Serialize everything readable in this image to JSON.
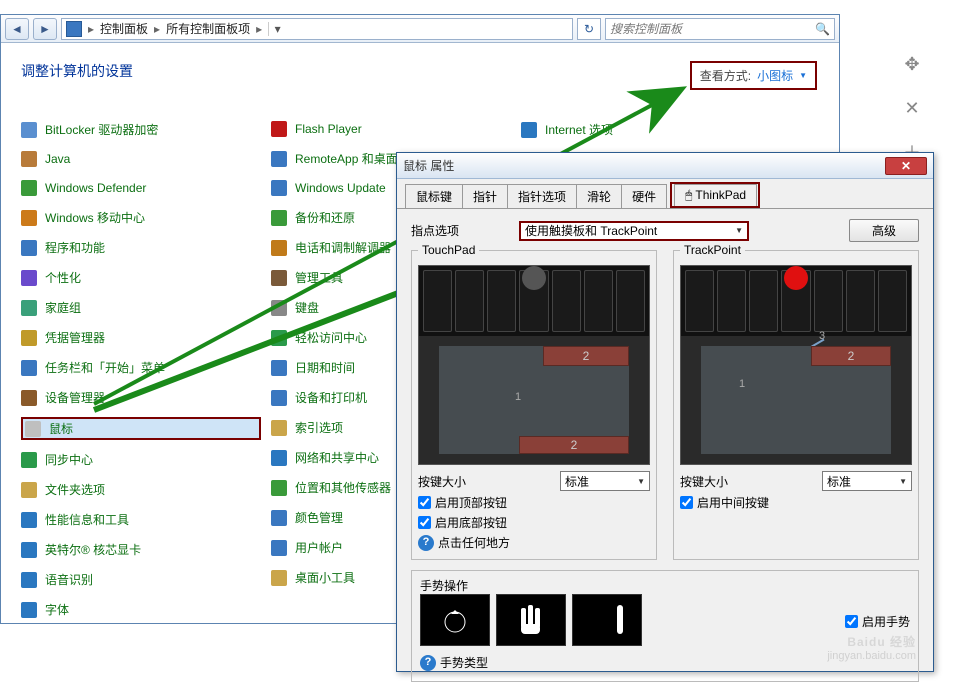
{
  "addr": {
    "crumb1": "控制面板",
    "crumb2": "所有控制面板项",
    "search_ph": "搜索控制面板"
  },
  "heading": "调整计算机的设置",
  "view": {
    "label": "查看方式:",
    "value": "小图标"
  },
  "cols": {
    "c1": [
      "BitLocker 驱动器加密",
      "Java",
      "Windows Defender",
      "Windows 移动中心",
      "程序和功能",
      "个性化",
      "家庭组",
      "凭据管理器",
      "任务栏和「开始」菜单",
      "设备管理器",
      "鼠标",
      "同步中心",
      "文件夹选项",
      "性能信息和工具",
      "英特尔® 核芯显卡",
      "语音识别",
      "字体"
    ],
    "c2": [
      "Flash Player",
      "RemoteApp 和桌面连接",
      "Windows Update",
      "备份和还原",
      "电话和调制解调器",
      "管理工具",
      "键盘",
      "轻松访问中心",
      "日期和时间",
      "设备和打印机",
      "索引选项",
      "网络和共享中心",
      "位置和其他传感器",
      "颜色管理",
      "用户帐户",
      "桌面小工具"
    ],
    "c3": [
      "Internet 选项"
    ]
  },
  "icons": {
    "c1": [
      "#5a8fd0",
      "#b87b3a",
      "#3a9a3a",
      "#cc7a1a",
      "#3a77c0",
      "#6a4acc",
      "#3aa07a",
      "#c09a2a",
      "#3a77c0",
      "#8a5a2a",
      "#bfbfbf",
      "#2a9a4a",
      "#caa54a",
      "#2a77c0",
      "#2a77c0",
      "#2a77c0",
      "#2a77c0"
    ],
    "c2": [
      "#c01818",
      "#3a77c0",
      "#3a77c0",
      "#3a9a3a",
      "#c07a1a",
      "#7a5a3a",
      "#888",
      "#2a9a4a",
      "#3a77c0",
      "#3a77c0",
      "#caa54a",
      "#2a77c0",
      "#3a9a3a",
      "#3a77c0",
      "#3a77c0",
      "#caa54a"
    ],
    "c3": [
      "#2a77c0"
    ]
  },
  "hl_item": "鼠标",
  "dlg": {
    "title": "鼠标 属性",
    "tabs": [
      "鼠标键",
      "指针",
      "指针选项",
      "滑轮",
      "硬件",
      "ThinkPad"
    ],
    "active_tab": 5,
    "option_label": "指点选项",
    "combo": "使用触摸板和 TrackPoint",
    "btn_adv": "高级",
    "left_title": "TouchPad",
    "right_title": "TrackPoint",
    "btn_size": "按键大小",
    "size_combo": "标准",
    "chk_top": "启用顶部按钮",
    "chk_bottom": "启用底部按钮",
    "chk_middle": "启用中间按键",
    "click_any": "点击任何地方",
    "gest_title": "手势操作",
    "gest_enable": "启用手势",
    "gest_type": "手势类型",
    "num1": "1",
    "num2": "2",
    "num3": "3"
  },
  "wm": {
    "brand": "Baidu 经验",
    "sub": "jingyan.baidu.com"
  }
}
